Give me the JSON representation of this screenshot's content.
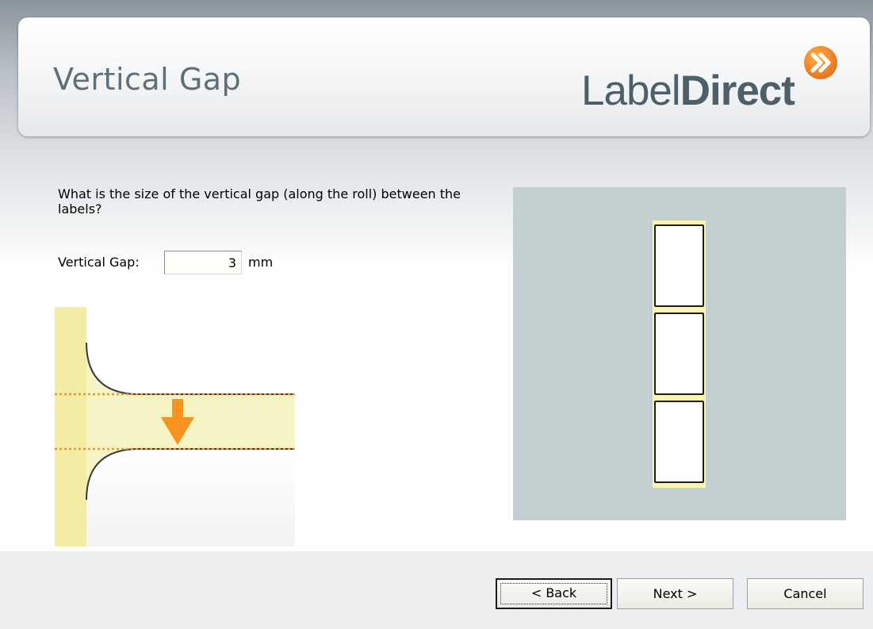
{
  "header": {
    "title": "Vertical Gap",
    "logo_light": "Label",
    "logo_bold": "Direct",
    "logo_mark_icon": "double-chevron-right-icon"
  },
  "form": {
    "question": "What is the size of the vertical gap (along the roll) between the labels?",
    "gap_label": "Vertical Gap:",
    "gap_value": "3",
    "gap_unit": "mm"
  },
  "illustration": {
    "arrow_icon": "arrow-down-icon"
  },
  "preview": {
    "label_count": 3
  },
  "buttons": {
    "back": "< Back",
    "next": "Next >",
    "cancel": "Cancel"
  },
  "colors": {
    "accent_orange": "#f7931e",
    "liner_yellow": "#fbf5b0",
    "preview_bg": "#c4cfd1"
  }
}
